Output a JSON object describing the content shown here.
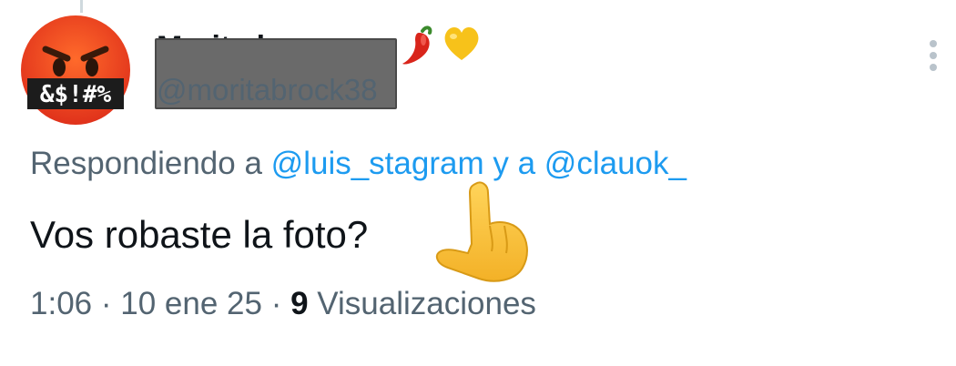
{
  "tweet": {
    "author": {
      "display_name": "Marita l...",
      "name_emojis": [
        "chili-pepper",
        "yellow-heart"
      ],
      "handle": "@moritabrock38",
      "avatar": {
        "icon": "angry-face-with-symbols-emoji",
        "overlay_text": "&$!#%"
      }
    },
    "reply": {
      "prefix": "Respondiendo a",
      "mentions": [
        "@luis_stagram",
        "@clauok_"
      ],
      "joiner": "y a"
    },
    "text": "Vos robaste la foto?",
    "meta": {
      "time": "1:06",
      "sep1": "·",
      "date": "10 ene 25",
      "sep2": "·",
      "views_count": "9",
      "views_label": "Visualizaciones"
    },
    "menu_icon": "more-vertical-icon"
  },
  "overlay": {
    "redaction": true,
    "sticker": "pointing-hand-emoji"
  },
  "colors": {
    "text_primary": "#0f1419",
    "text_secondary": "#536471",
    "mention": "#1d9bf0",
    "redaction": "#6a6a6a"
  }
}
